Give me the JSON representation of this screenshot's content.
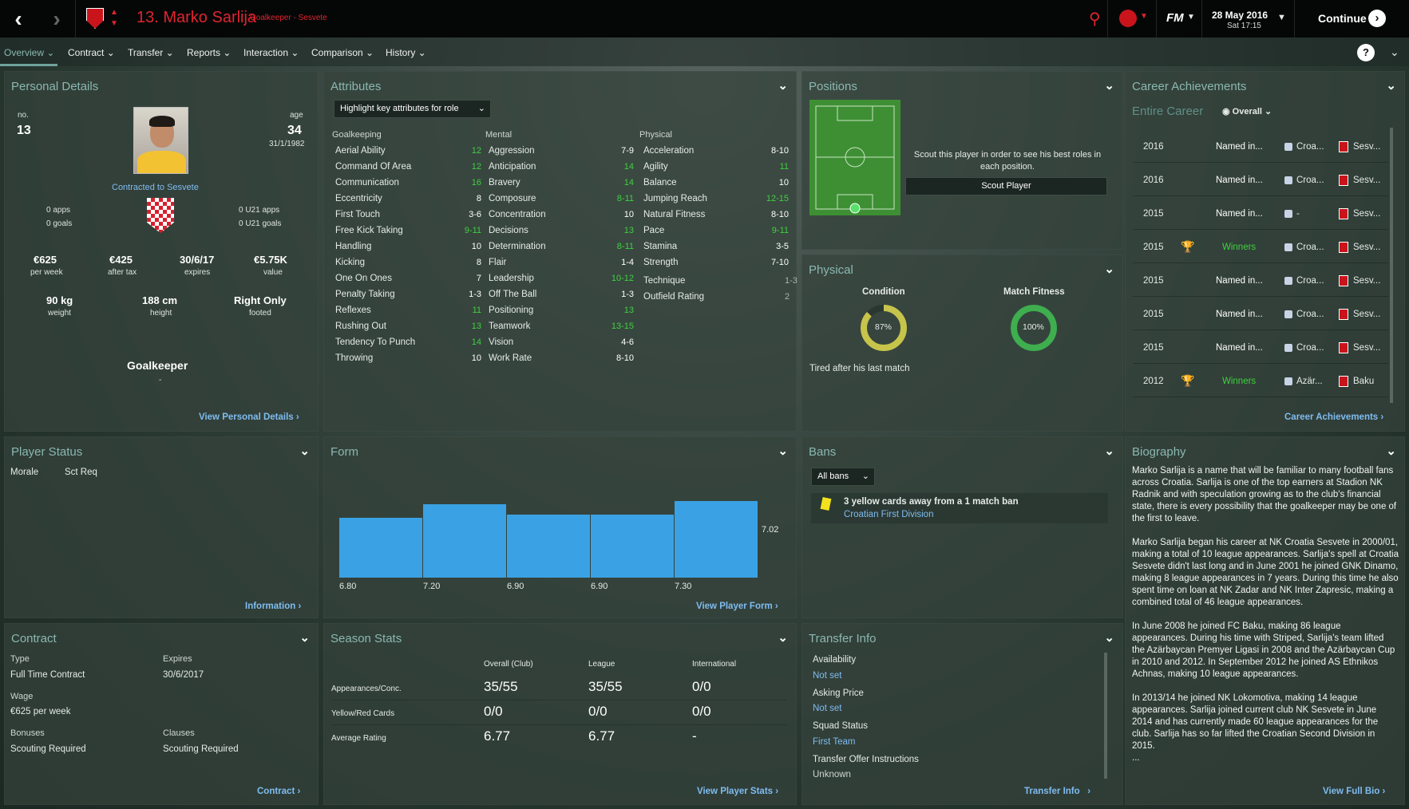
{
  "header": {
    "title": "13. Marko Sarlija",
    "subtitle": "Goalkeeper - Sesvete",
    "date": "28 May 2016",
    "time": "Sat 17:15",
    "continue": "Continue",
    "fm": "FM"
  },
  "menu": [
    "Overview",
    "Contract",
    "Transfer",
    "Reports",
    "Interaction",
    "Comparison",
    "History"
  ],
  "personal": {
    "title": "Personal Details",
    "no_label": "no.",
    "no": "13",
    "age_label": "age",
    "age": "34",
    "dob": "31/1/1982",
    "contracted": "Contracted to Sesvete",
    "apps": "0 apps",
    "goals": "0 goals",
    "u21apps": "0 U21 apps",
    "u21goals": "0 U21 goals",
    "wage": "€625",
    "wage_l": "per week",
    "aftertax": "€425",
    "aftertax_l": "after tax",
    "expires": "30/6/17",
    "expires_l": "expires",
    "value": "€5.75K",
    "value_l": "value",
    "weight": "90 kg",
    "weight_l": "weight",
    "height": "188 cm",
    "height_l": "height",
    "foot": "Right Only",
    "foot_l": "footed",
    "position": "Goalkeeper",
    "dash": "-",
    "link": "View Personal Details"
  },
  "attributes": {
    "title": "Attributes",
    "dropdown": "Highlight key attributes for role",
    "gk_h": "Goalkeeping",
    "mental_h": "Mental",
    "phys_h": "Physical",
    "gk": [
      [
        "Aerial Ability",
        "12"
      ],
      [
        "Command Of Area",
        "12"
      ],
      [
        "Communication",
        "16"
      ],
      [
        "Eccentricity",
        "8"
      ],
      [
        "First Touch",
        "3-6"
      ],
      [
        "Free Kick Taking",
        "9-11"
      ],
      [
        "Handling",
        "10"
      ],
      [
        "Kicking",
        "8"
      ],
      [
        "One On Ones",
        "7"
      ],
      [
        "Penalty Taking",
        "1-3"
      ],
      [
        "Reflexes",
        "11"
      ],
      [
        "Rushing Out",
        "13"
      ],
      [
        "Tendency To Punch",
        "14"
      ],
      [
        "Throwing",
        "10"
      ]
    ],
    "mental": [
      [
        "Aggression",
        "7-9"
      ],
      [
        "Anticipation",
        "14"
      ],
      [
        "Bravery",
        "14"
      ],
      [
        "Composure",
        "8-11"
      ],
      [
        "Concentration",
        "10"
      ],
      [
        "Decisions",
        "13"
      ],
      [
        "Determination",
        "8-11"
      ],
      [
        "Flair",
        "1-4"
      ],
      [
        "Leadership",
        "10-12"
      ],
      [
        "Off The Ball",
        "1-3"
      ],
      [
        "Positioning",
        "13"
      ],
      [
        "Teamwork",
        "13-15"
      ],
      [
        "Vision",
        "4-6"
      ],
      [
        "Work Rate",
        "8-10"
      ]
    ],
    "physical": [
      [
        "Acceleration",
        "8-10"
      ],
      [
        "Agility",
        "11"
      ],
      [
        "Balance",
        "10"
      ],
      [
        "Jumping Reach",
        "12-15"
      ],
      [
        "Natural Fitness",
        "8-10"
      ],
      [
        "Pace",
        "9-11"
      ],
      [
        "Stamina",
        "3-5"
      ],
      [
        "Strength",
        "7-10"
      ]
    ],
    "technique": [
      "Technique",
      "1-3"
    ],
    "outfield": [
      "Outfield Rating",
      "2"
    ]
  },
  "positions": {
    "title": "Positions",
    "msg": "Scout this player in order to see his best roles in each position.",
    "button": "Scout Player"
  },
  "physical": {
    "title": "Physical",
    "condition_l": "Condition",
    "condition": "87%",
    "condition_v": 87,
    "fitness_l": "Match Fitness",
    "fitness": "100%",
    "fitness_v": 100,
    "note": "Tired after his last match"
  },
  "career": {
    "title": "Career Achievements",
    "tab": "Entire Career",
    "dropdown": "Overall",
    "link": "Career Achievements",
    "rows": [
      [
        "2016",
        "Named in...",
        "Croa...",
        "Sesv..."
      ],
      [
        "2016",
        "Named in...",
        "Croa...",
        "Sesv..."
      ],
      [
        "2015",
        "Named in...",
        "-",
        "Sesv..."
      ],
      [
        "2015",
        "Winners",
        "Croa...",
        "Sesv..."
      ],
      [
        "2015",
        "Named in...",
        "Croa...",
        "Sesv..."
      ],
      [
        "2015",
        "Named in...",
        "Croa...",
        "Sesv..."
      ],
      [
        "2015",
        "Named in...",
        "Croa...",
        "Sesv..."
      ],
      [
        "2012",
        "Winners",
        "Azär...",
        "Baku"
      ]
    ]
  },
  "status": {
    "title": "Player Status",
    "morale": "Morale",
    "sct": "Sct Req",
    "link": "Information"
  },
  "form": {
    "title": "Form",
    "avg": "7.02",
    "link": "View Player Form",
    "labels": [
      "6.80",
      "7.20",
      "6.90",
      "6.90",
      "7.30"
    ]
  },
  "chart_data": {
    "type": "bar",
    "categories": [
      "6.80",
      "7.20",
      "6.90",
      "6.90",
      "7.30"
    ],
    "values": [
      6.8,
      7.2,
      6.9,
      6.9,
      7.3
    ],
    "title": "Form",
    "average": 7.02
  },
  "bans": {
    "title": "Bans",
    "dropdown": "All bans",
    "msg": "3 yellow cards away from a 1 match ban",
    "comp": "Croatian First Division"
  },
  "bio": {
    "title": "Biography",
    "link": "View Full Bio",
    "paras": [
      "Marko Sarlija is a name that will be familiar to many football fans across Croatia. Sarlija is one of the top earners at Stadion NK Radnik and with speculation growing as to the club's financial state, there is every possibility that the goalkeeper may be one of the first to leave.",
      "Marko Sarlija began his career at NK Croatia Sesvete in 2000/01, making a total of 10 league appearances. Sarlija's spell at Croatia Sesvete didn't last long and in June 2001 he joined GNK Dinamo, making 8 league appearances in 7 years. During this time he also spent time on loan at NK Zadar and NK Inter Zapresic, making a combined total of 46 league appearances.",
      "In June 2008 he joined FC Baku, making 86 league appearances. During his time with Striped, Sarlija's team lifted the Azärbaycan Premyer Ligasi in 2008 and the Azärbaycan Cup in 2010 and 2012. In September 2012 he joined AS Ethnikos Achnas, making 10 league appearances.",
      "In 2013/14 he joined NK Lokomotiva, making 14 league appearances.  Sarlija joined current club NK Sesvete in June 2014 and has currently made 60 league appearances for the club. Sarlija has so far lifted the Croatian Second Division in 2015.",
      "..."
    ]
  },
  "contract": {
    "title": "Contract",
    "type_l": "Type",
    "type": "Full Time Contract",
    "exp_l": "Expires",
    "exp": "30/6/2017",
    "wage_l": "Wage",
    "wage": "€625 per week",
    "bon_l": "Bonuses",
    "bon": "Scouting Required",
    "cla_l": "Clauses",
    "cla": "Scouting Required",
    "link": "Contract"
  },
  "season": {
    "title": "Season Stats",
    "cols": [
      "Overall (Club)",
      "League",
      "International"
    ],
    "rows": [
      [
        "Appearances/Conc.",
        "35/55",
        "35/55",
        "0/0"
      ],
      [
        "Yellow/Red Cards",
        "0/0",
        "0/0",
        "0/0"
      ],
      [
        "Average Rating",
        "6.77",
        "6.77",
        "-"
      ]
    ],
    "link": "View Player Stats"
  },
  "transfer": {
    "title": "Transfer Info",
    "avail_l": "Availability",
    "avail": "Not set",
    "ask_l": "Asking Price",
    "ask": "Not set",
    "squad_l": "Squad Status",
    "squad": "First Team",
    "toi_l": "Transfer Offer Instructions",
    "toi": "Unknown",
    "link": "Transfer Info"
  },
  "colors": {
    "accent": "#8ab8b0",
    "link": "#7fbcf0",
    "good": "#3ed13e",
    "bar": "#3aa2e4",
    "red": "#e0242e"
  }
}
